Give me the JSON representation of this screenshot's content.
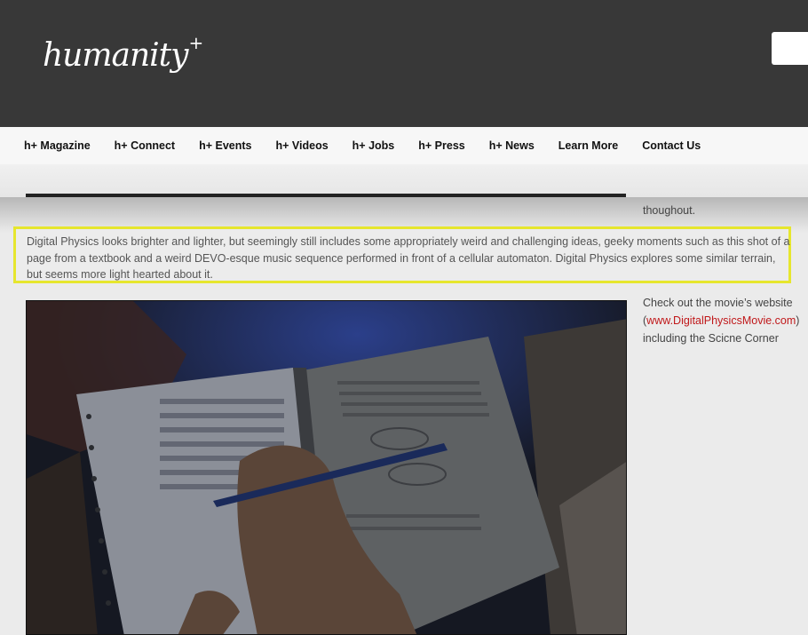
{
  "header": {
    "logo_text": "humanity",
    "logo_sup": "+"
  },
  "nav": {
    "items": [
      {
        "label": "h+ Magazine"
      },
      {
        "label": "h+ Connect"
      },
      {
        "label": "h+ Events"
      },
      {
        "label": "h+ Videos"
      },
      {
        "label": "h+ Jobs"
      },
      {
        "label": "h+ Press"
      },
      {
        "label": "h+ News"
      },
      {
        "label": "Learn More"
      },
      {
        "label": "Contact Us"
      }
    ]
  },
  "sidebar": {
    "previous_text": "thoughout.",
    "movie_text_1": "Check out the movie’s website (",
    "movie_link": "www.DigitalPhysicsMovie.com",
    "movie_text_2": ") including the Scicne Corner"
  },
  "article": {
    "highlighted_paragraph": "Digital Physics looks brighter and lighter, but seemingly still includes some appropriately weird and challenging ideas, geeky moments such as this shot of a page from a textbook and a weird DEVO-esque music sequence performed in front of a cellular automaton. Digital Physics explores some similar terrain, but seems more light hearted about it."
  },
  "colors": {
    "header_bg": "#383838",
    "highlight_border": "#e6e62e",
    "link": "#c0181a"
  }
}
